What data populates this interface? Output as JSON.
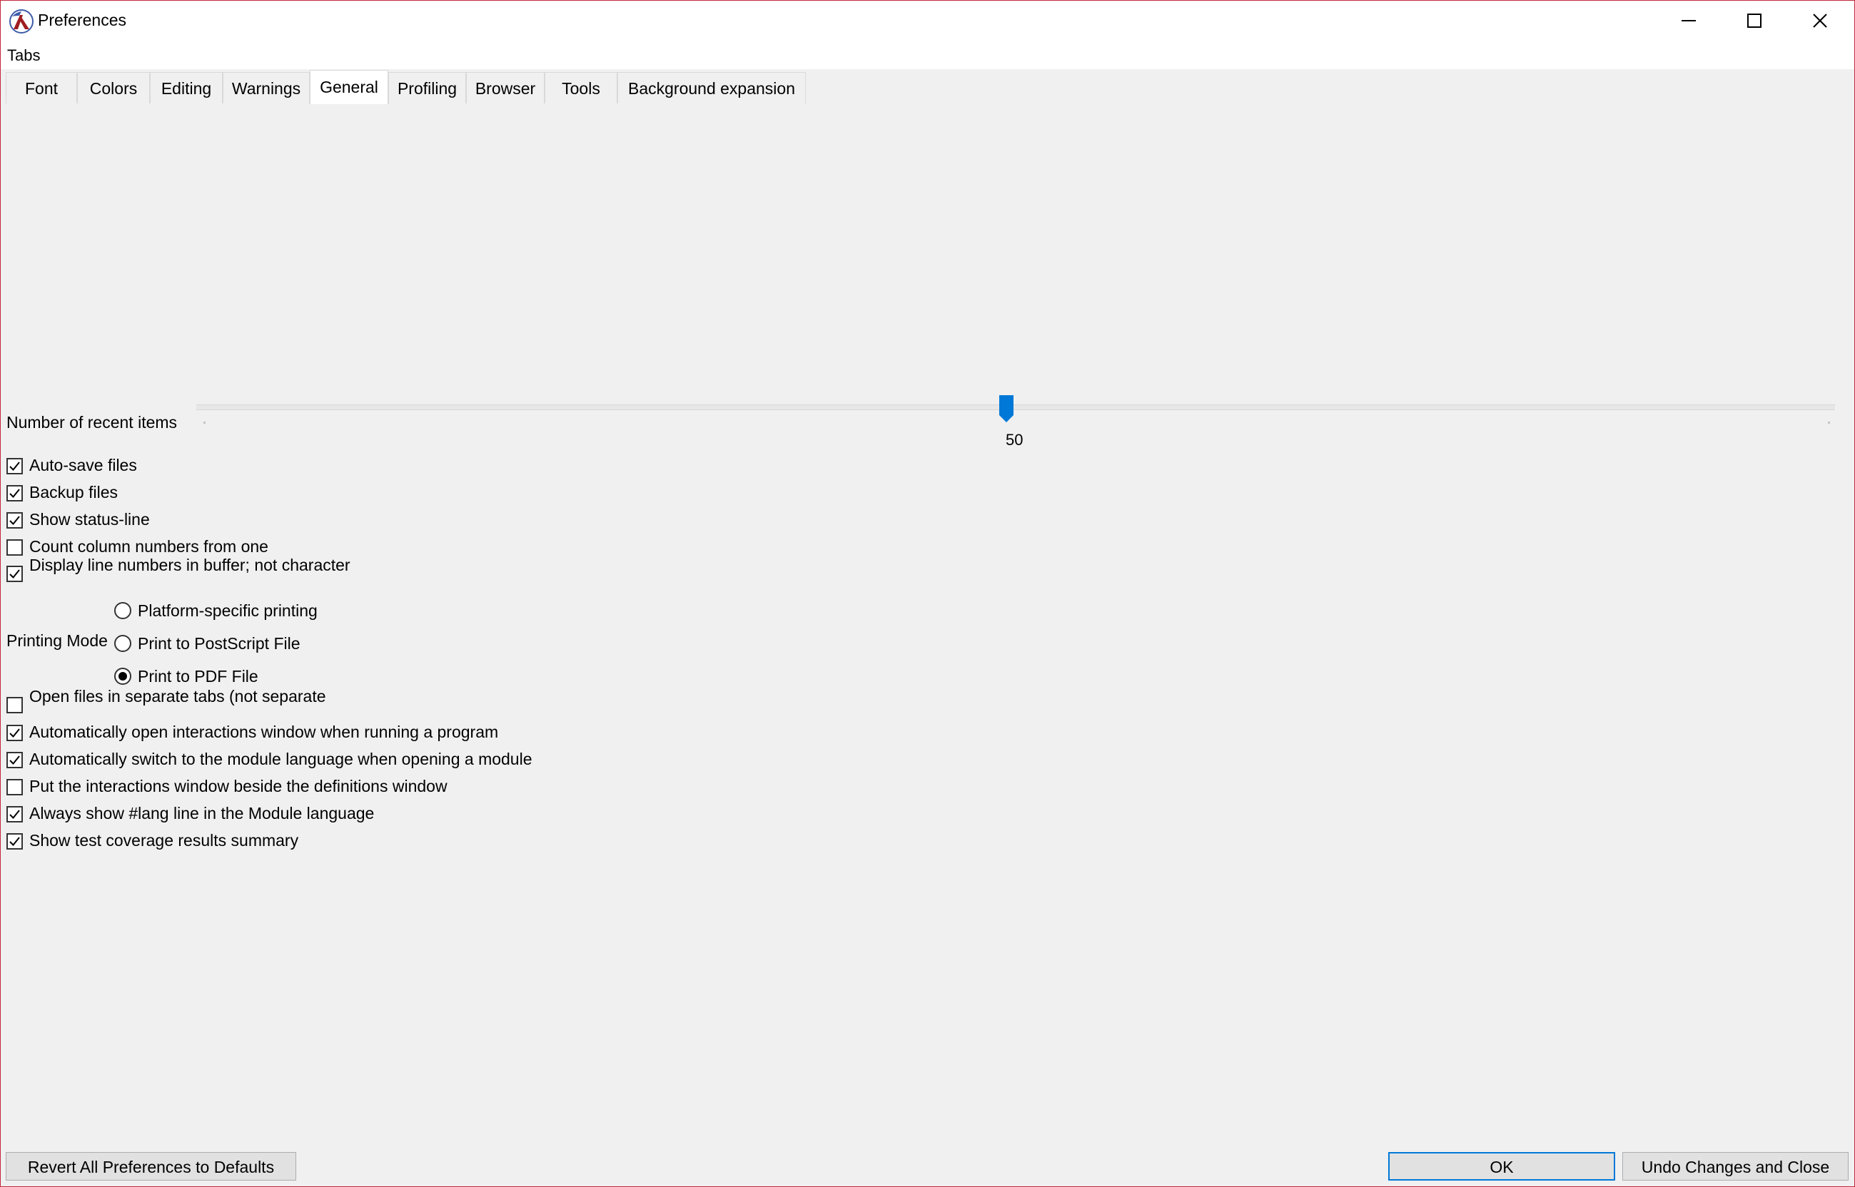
{
  "window": {
    "title": "Preferences",
    "brand_color": "#c2273b",
    "accent_color": "#0078d7"
  },
  "menu": {
    "tabs_label": "Tabs"
  },
  "tabs": [
    {
      "label": "Font",
      "active": false
    },
    {
      "label": "Colors",
      "active": false
    },
    {
      "label": "Editing",
      "active": false
    },
    {
      "label": "Warnings",
      "active": false
    },
    {
      "label": "General",
      "active": true
    },
    {
      "label": "Profiling",
      "active": false
    },
    {
      "label": "Browser",
      "active": false
    },
    {
      "label": "Tools",
      "active": false
    },
    {
      "label": "Background expansion",
      "active": false
    }
  ],
  "slider": {
    "label": "Number of recent items",
    "value": "50"
  },
  "checkboxes_top": [
    {
      "label": "Auto-save files",
      "checked": true
    },
    {
      "label": "Backup files",
      "checked": true
    },
    {
      "label": "Show status-line",
      "checked": true
    },
    {
      "label": "Count column numbers from one",
      "checked": false
    },
    {
      "label": "Display line numbers in buffer; not character offsets",
      "checked": true
    }
  ],
  "printing": {
    "label": "Printing Mode",
    "options": [
      {
        "label": "Platform-specific printing",
        "selected": false
      },
      {
        "label": "Print to PostScript File",
        "selected": false
      },
      {
        "label": "Print to PDF File",
        "selected": true
      }
    ]
  },
  "checkboxes_bottom": [
    {
      "label": "Open files in separate tabs (not separate windows)",
      "checked": false
    },
    {
      "label": "Automatically open interactions window when running a program",
      "checked": true
    },
    {
      "label": "Automatically switch to the module language when opening a module",
      "checked": true
    },
    {
      "label": "Put the interactions window beside the definitions window",
      "checked": false
    },
    {
      "label": "Always show #lang line in the Module language",
      "checked": true
    },
    {
      "label": "Show test coverage results summary",
      "checked": true
    }
  ],
  "buttons": {
    "revert": "Revert All Preferences to Defaults",
    "ok": "OK",
    "undo_close": "Undo Changes and Close"
  },
  "icons": {
    "app": "racket-logo-icon",
    "minimize": "minimize-icon",
    "maximize": "maximize-icon",
    "close": "close-icon",
    "check": "checkmark-icon"
  }
}
